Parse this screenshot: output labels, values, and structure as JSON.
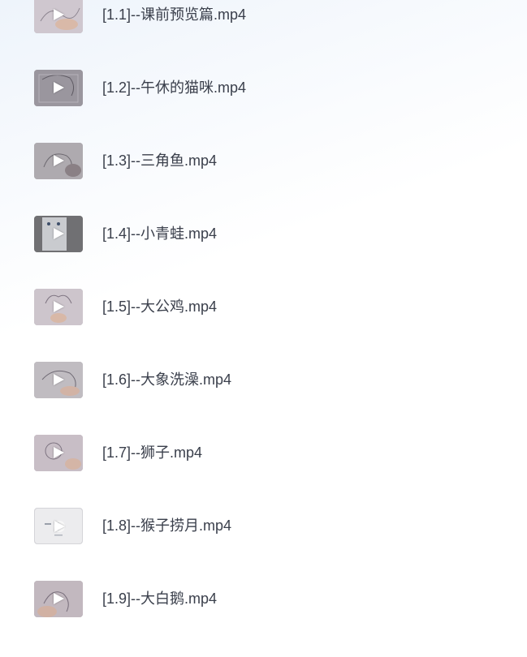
{
  "videos": [
    {
      "title": "[1.1]--课前预览篇.mp4",
      "thumb_color": "#c9c2c9",
      "icon": "play-icon"
    },
    {
      "title": "[1.2]--午休的猫咪.mp4",
      "thumb_color": "#8e8a93",
      "icon": "play-icon"
    },
    {
      "title": "[1.3]--三角鱼.mp4",
      "thumb_color": "#a7a3a8",
      "icon": "play-icon"
    },
    {
      "title": "[1.4]--小青蛙.mp4",
      "thumb_color": "#6d6d70",
      "icon": "play-icon"
    },
    {
      "title": "[1.5]--大公鸡.mp4",
      "thumb_color": "#c7bfc6",
      "icon": "play-icon"
    },
    {
      "title": "[1.6]--大象洗澡.mp4",
      "thumb_color": "#b9b5ba",
      "icon": "play-icon"
    },
    {
      "title": "[1.7]--狮子.mp4",
      "thumb_color": "#c3b9c1",
      "icon": "play-icon"
    },
    {
      "title": "[1.8]--猴子捞月.mp4",
      "thumb_color": "#e8e8ea",
      "icon": "play-icon"
    },
    {
      "title": "[1.9]--大白鹅.mp4",
      "thumb_color": "#bcb3ba",
      "icon": "play-icon"
    }
  ]
}
